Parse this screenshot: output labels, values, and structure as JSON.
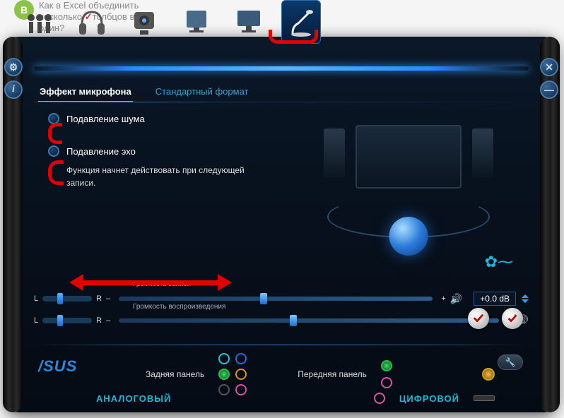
{
  "background": {
    "avatar": "В",
    "question": "Как в Excel объединить\nнесколько столбцов в\nодин?"
  },
  "sidebuttons": {
    "gear": "⚙",
    "info": "i",
    "close": "✕",
    "minimize": "—"
  },
  "devices": [
    "jacks",
    "headphones",
    "webcam",
    "desktop",
    "monitor",
    "microphone"
  ],
  "tabs": [
    {
      "label": "Эффект микрофона",
      "active": true
    },
    {
      "label": "Стандартный формат",
      "active": false
    }
  ],
  "options": {
    "noise": {
      "label": "Подавление шума",
      "checked": false
    },
    "echo": {
      "label": "Подавление эхо",
      "checked": false
    },
    "note": "Функция начнет действовать при следующей записи."
  },
  "sliders": {
    "recording": {
      "title": "Громкость записи",
      "l": "L",
      "r": "R",
      "minus": "–",
      "plus": "+",
      "db": "+0.0 dB"
    },
    "playback": {
      "title": "Громкость воспроизведения",
      "l": "L",
      "r": "R",
      "minus": "–",
      "plus": "+"
    }
  },
  "footer": {
    "brand": "/SUS",
    "rear": "Задняя панель",
    "front": "Передняя панель",
    "analog": "АНАЛОГОВЫЙ",
    "digital": "ЦИФРОВОЙ"
  }
}
